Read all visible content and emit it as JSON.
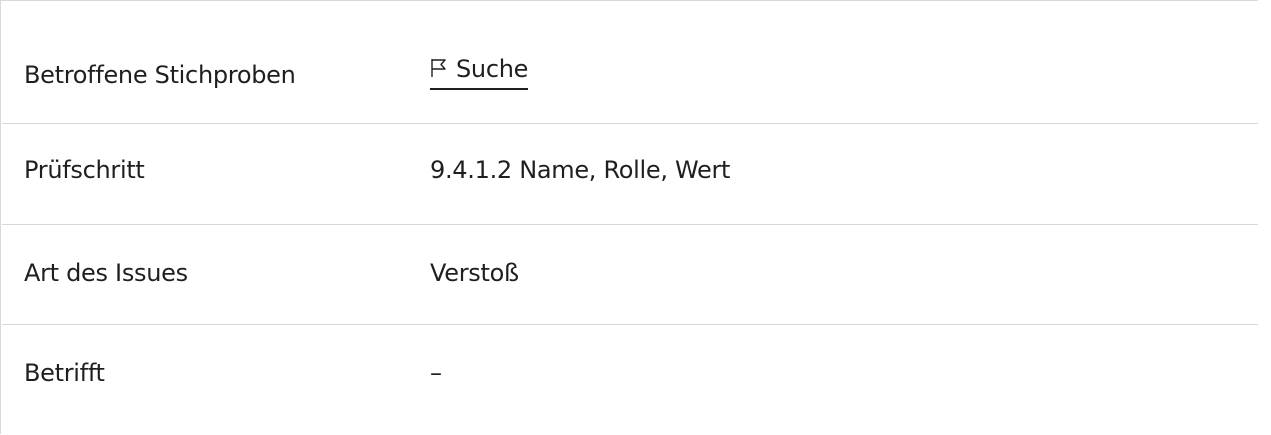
{
  "rows": [
    {
      "label": "Betroffene Stichproben",
      "value": "Suche",
      "icon": "flag-icon",
      "is_link": true
    },
    {
      "label": "Prüfschritt",
      "value": "9.4.1.2 Name, Rolle, Wert"
    },
    {
      "label": "Art des Issues",
      "value": "Verstoß"
    },
    {
      "label": "Betrifft",
      "value": "–"
    }
  ]
}
